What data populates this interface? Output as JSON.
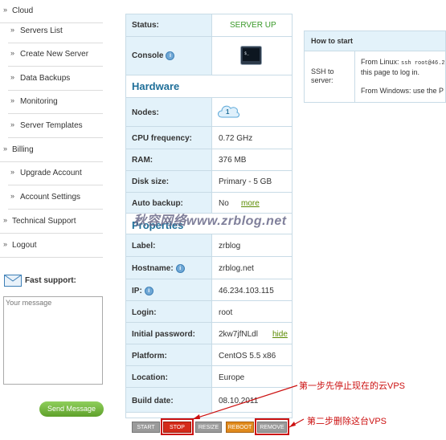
{
  "sidebar": {
    "items": [
      {
        "label": "Cloud",
        "sub": false
      },
      {
        "label": "Servers List",
        "sub": true
      },
      {
        "label": "Create New Server",
        "sub": true
      },
      {
        "label": "Data Backups",
        "sub": true
      },
      {
        "label": "Monitoring",
        "sub": true
      },
      {
        "label": "Server Templates",
        "sub": true
      },
      {
        "label": "Billing",
        "sub": false
      },
      {
        "label": "Upgrade Account",
        "sub": true
      },
      {
        "label": "Account Settings",
        "sub": true
      },
      {
        "label": "Technical Support",
        "sub": false
      },
      {
        "label": "Logout",
        "sub": false
      }
    ],
    "arrow": "»"
  },
  "support": {
    "title": "Fast support:",
    "placeholder": "Your message",
    "send_label": "Send Message"
  },
  "server": {
    "status_label": "Status:",
    "status_value": "SERVER UP",
    "console_label": "Console",
    "hardware_heading": "Hardware",
    "nodes_label": "Nodes:",
    "nodes_value": "1",
    "cpu_label": "CPU frequency:",
    "cpu_value": "0.72 GHz",
    "ram_label": "RAM:",
    "ram_value": "376 MB",
    "disk_label": "Disk size:",
    "disk_value": "Primary - 5 GB",
    "backup_label": "Auto backup:",
    "backup_value": "No",
    "backup_more": "more",
    "properties_heading": "Properties",
    "label_label": "Label:",
    "label_value": "zrblog",
    "hostname_label": "Hostname:",
    "hostname_value": "zrblog.net",
    "ip_label": "IP:",
    "ip_value": "46.234.103.115",
    "login_label": "Login:",
    "login_value": "root",
    "password_label": "Initial password:",
    "password_value": "2kw7jfNLdl",
    "password_hide": "hide",
    "platform_label": "Platform:",
    "platform_value": "CentOS 5.5 x86",
    "location_label": "Location:",
    "location_value": "Europe",
    "build_label": "Build date:",
    "build_value": "08.10.2011",
    "info_glyph": "i"
  },
  "actions": {
    "start": "START",
    "stop": "STOP",
    "resize": "RESIZE",
    "reboot": "REBOOT",
    "remove": "REMOVE"
  },
  "howto": {
    "title": "How to start",
    "ssh_label": "SSH to server:",
    "linux_text": "From Linux: ",
    "linux_cmd": "ssh root@46.2",
    "linux_text2": "this page to log in.",
    "windows_text": "From Windows: use the P"
  },
  "watermark": "秋容网络www.zrblog.net",
  "annotations": {
    "step1": "第一步先停止现在的云VPS",
    "step2": "第二步删除这台VPS"
  },
  "colors": {
    "status_green": "#3a9a2a",
    "heading_blue": "#1f6f99",
    "key_bg": "#e3f2fa",
    "link_green": "#5a8a00",
    "stop_red": "#d42a1a",
    "annotation_red": "#cc1111",
    "send_green": "#6cb33c"
  }
}
